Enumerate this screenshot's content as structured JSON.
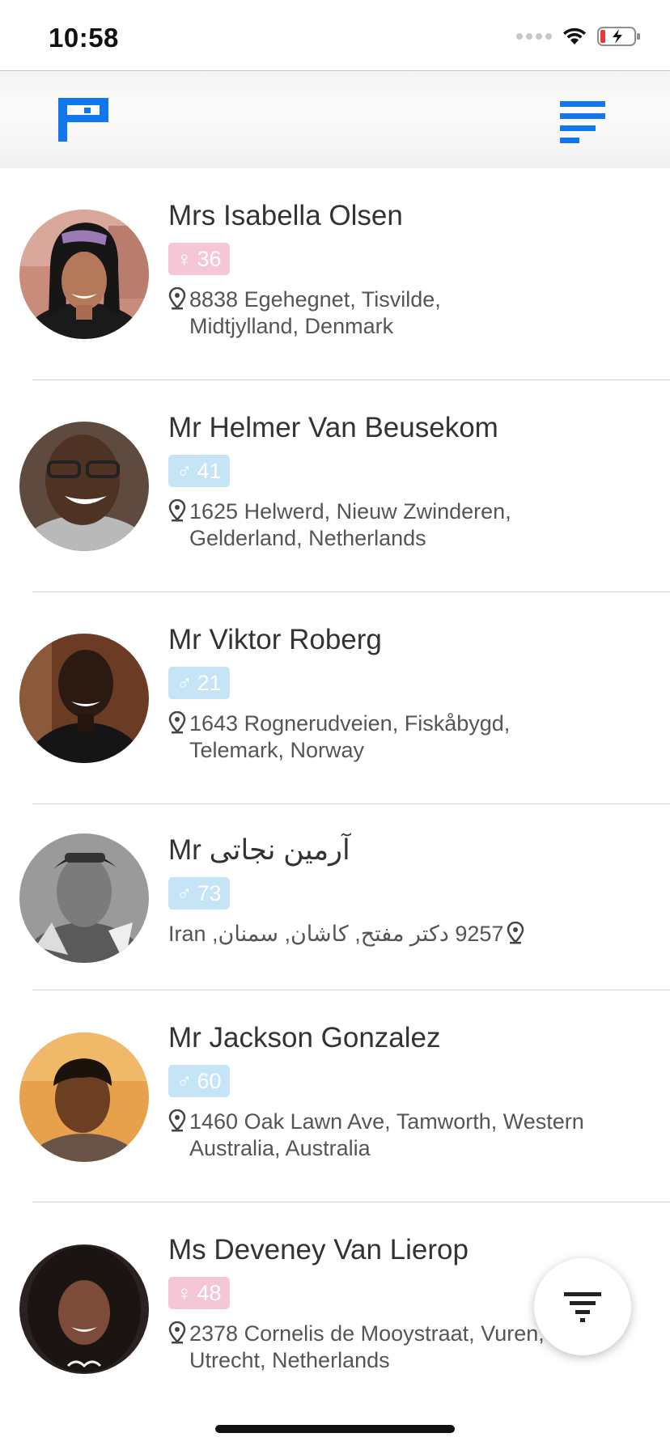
{
  "status_bar": {
    "time": "10:58"
  },
  "header": {
    "logo_icon": "brand-flag-icon",
    "menu_icon": "menu-lines-icon",
    "accent": "#1177ee"
  },
  "users": [
    {
      "name": "Mrs Isabella Olsen",
      "gender": "female",
      "gender_symbol": "♀",
      "age": "36",
      "address_line1": "8838 Egehegnet, Tisvilde,",
      "address_line2": "Midtjylland, Denmark"
    },
    {
      "name": "Mr Helmer Van Beusekom",
      "gender": "male",
      "gender_symbol": "♂",
      "age": "41",
      "address_line1": "1625 Helwerd, Nieuw Zwinderen,",
      "address_line2": "Gelderland, Netherlands"
    },
    {
      "name": "Mr Viktor Roberg",
      "gender": "male",
      "gender_symbol": "♂",
      "age": "21",
      "address_line1": "1643 Rognerudveien, Fiskåbygd,",
      "address_line2": "Telemark, Norway"
    },
    {
      "name": "Mr آرمین نجاتی",
      "gender": "male",
      "gender_symbol": "♂",
      "age": "73",
      "address_line1": "9257 دکتر مفتح, کاشان, سمنان, Iran",
      "address_line2": ""
    },
    {
      "name": "Mr Jackson Gonzalez",
      "gender": "male",
      "gender_symbol": "♂",
      "age": "60",
      "address_line1": "1460 Oak Lawn Ave, Tamworth, Western",
      "address_line2": "Australia, Australia"
    },
    {
      "name": "Ms Deveney Van Lierop",
      "gender": "female",
      "gender_symbol": "♀",
      "age": "48",
      "address_line1": "2378 Cornelis de Mooystraat, Vuren,",
      "address_line2": "Utrecht, Netherlands"
    }
  ],
  "fab": {
    "icon": "filter-icon"
  },
  "colors": {
    "female_badge": "#f5c7d6",
    "male_badge": "#c5e5f6"
  }
}
